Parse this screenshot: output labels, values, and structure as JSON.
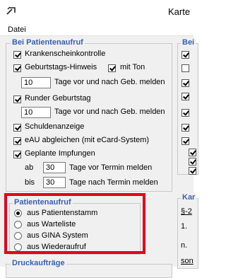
{
  "window": {
    "title": "Karte"
  },
  "menu": {
    "items": [
      "Datei"
    ]
  },
  "patientenaufruf_group": {
    "title": "Bei Patientenaufruf",
    "krankenschein": "Krankenscheinkontrolle",
    "geburtstag": "Geburtstags-Hinweis",
    "mit_ton": "mit Ton",
    "geburtstag_days": "10",
    "days_label": "Tage vor und nach Geb. melden",
    "runder": "Runder Geburtstag",
    "runder_days": "10",
    "runder_days_label": "Tage vor und nach Geb. melden",
    "schulden": "Schuldenanzeige",
    "eau": "eAU abgleichen (mit eCard-System)",
    "impfungen": "Geplante Impfungen",
    "ab_label": "ab",
    "ab_value": "30",
    "ab_text": "Tage vor Termin melden",
    "bis_label": "bis",
    "bis_value": "30",
    "bis_text": "Tage nach Termin melden"
  },
  "patientenaufruf_radio": {
    "title": "Patientenaufruf",
    "options": [
      "aus Patientenstamm",
      "aus Warteliste",
      "aus GINA System",
      "aus Wiederaufruf"
    ],
    "selected_index": 0
  },
  "bottom_group": {
    "title": "Druckaufträge"
  },
  "right_panel": {
    "group1_title": "Bei",
    "group2_title": "Kar",
    "text1": "§-2",
    "text2": "1.",
    "text3": "n.",
    "text4": "son"
  },
  "colors": {
    "group_title": "#3a5fb0",
    "highlight": "#e3001b"
  },
  "icons": {
    "app": "karte-app-icon"
  }
}
